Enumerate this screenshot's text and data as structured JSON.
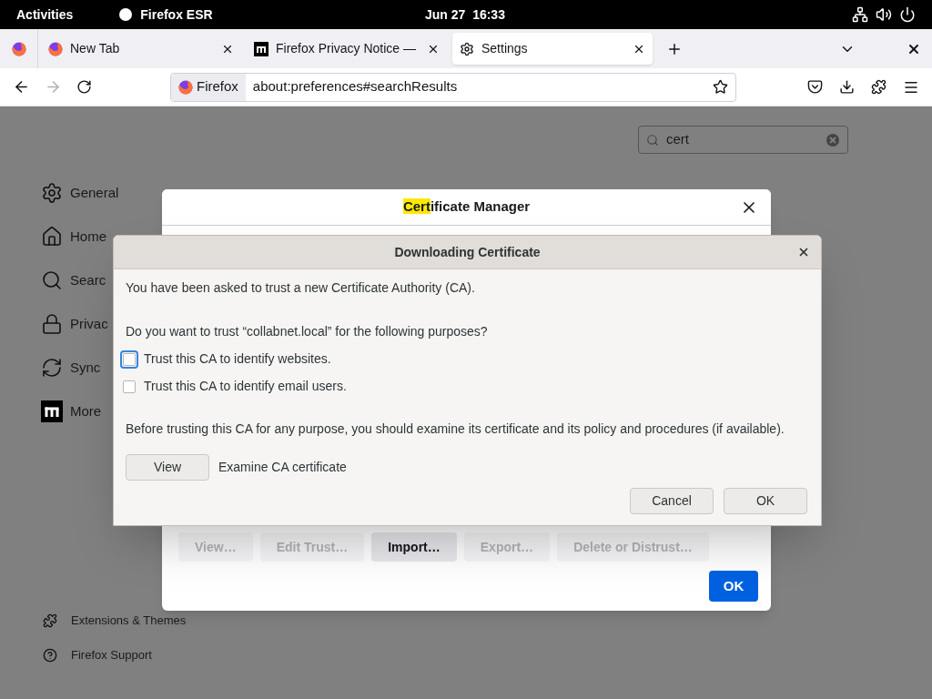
{
  "top_bar": {
    "activities": "Activities",
    "app": "Firefox ESR",
    "clock": "Jun 27  16:33"
  },
  "tabs": [
    {
      "kind": "pinned",
      "selected": false
    },
    {
      "kind": "firefox",
      "label": "New Tab",
      "selected": false
    },
    {
      "kind": "mozilla",
      "label": "Firefox Privacy Notice —",
      "selected": false
    },
    {
      "kind": "settings",
      "label": "Settings",
      "selected": true
    }
  ],
  "address_bar": {
    "identity": "Firefox",
    "url": "about:preferences#searchResults"
  },
  "search": {
    "value": "cert"
  },
  "sidebar": {
    "items": [
      {
        "kind": "gear",
        "label": "General"
      },
      {
        "kind": "home",
        "label": "Home"
      },
      {
        "kind": "search",
        "label": "Searc"
      },
      {
        "kind": "lock",
        "label": "Privac"
      },
      {
        "kind": "sync",
        "label": "Sync"
      },
      {
        "kind": "mozilla",
        "label": "More"
      }
    ],
    "footer": [
      {
        "kind": "puzzle",
        "label": "Extensions & Themes"
      },
      {
        "kind": "help",
        "label": "Firefox Support"
      }
    ]
  },
  "certificate_manager": {
    "title_match": "Cert",
    "title_rest": "ificate Manager",
    "buttons": [
      {
        "label": "View…",
        "disabled": true
      },
      {
        "label": "Edit Trust…",
        "disabled": true
      },
      {
        "label": "Import…",
        "disabled": false
      },
      {
        "label": "Export…",
        "disabled": true
      },
      {
        "label": "Delete or Distrust…",
        "disabled": true
      }
    ],
    "ok": "OK"
  },
  "download_dialog": {
    "title": "Downloading Certificate",
    "intro": "You have been asked to trust a new Certificate Authority (CA).",
    "question": "Do you want to trust “collabnet.local” for the following purposes?",
    "options": [
      {
        "label": "Trust this CA to identify websites.",
        "checked": false,
        "focused": true
      },
      {
        "label": "Trust this CA to identify email users.",
        "checked": false,
        "focused": false
      }
    ],
    "note": "Before trusting this CA for any purpose, you should examine its certificate and its policy and procedures (if available).",
    "view_button": "View",
    "view_label": "Examine CA certificate",
    "cancel": "Cancel",
    "ok": "OK"
  }
}
